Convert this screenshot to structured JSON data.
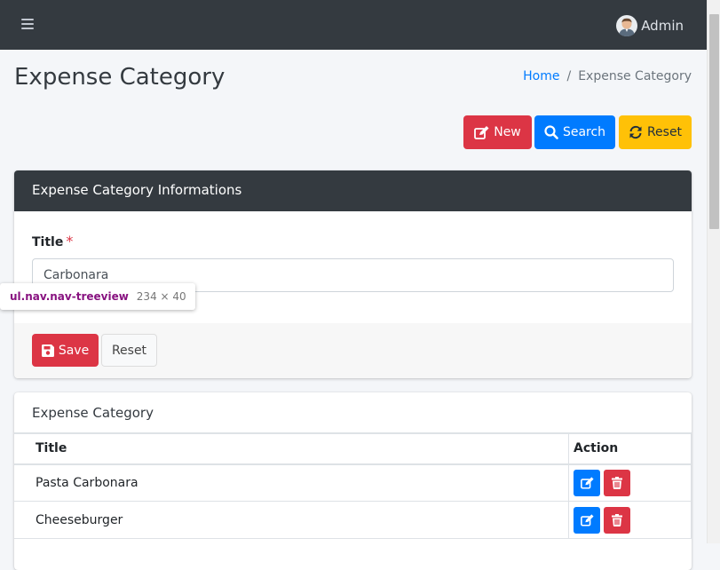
{
  "navbar": {
    "menu_icon": "hamburger-icon",
    "user_name": "Admin",
    "avatar_icon": "user-avatar-icon"
  },
  "header": {
    "title": "Expense Category",
    "breadcrumb": {
      "home": "Home",
      "separator": "/",
      "current": "Expense Category"
    }
  },
  "actions": {
    "new_label": "New",
    "search_label": "Search",
    "reset_label": "Reset"
  },
  "form": {
    "header": "Expense Category Informations",
    "title_label": "Title",
    "required_mark": "*",
    "title_value": "Carbonara",
    "save_label": "Save",
    "reset_label": "Reset"
  },
  "tooltip": {
    "selector": "ul.nav.nav-treeview",
    "dims": "234 × 40"
  },
  "list": {
    "header": "Expense Category",
    "columns": {
      "title": "Title",
      "action": "Action"
    },
    "rows": [
      {
        "title": "Pasta Carbonara"
      },
      {
        "title": "Cheeseburger"
      }
    ]
  },
  "colors": {
    "navbar": "#343a40",
    "danger": "#dc3545",
    "primary": "#007bff",
    "warning": "#ffc107"
  }
}
